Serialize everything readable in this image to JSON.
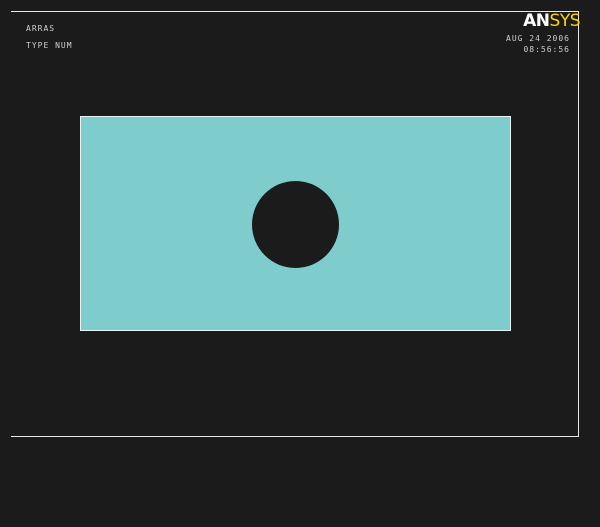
{
  "header": {
    "left_line1": "ARRAS",
    "left_line2": "TYPE NUM",
    "date": "AUG 24 2006",
    "time": "08:56:56"
  },
  "logo": {
    "part1": "AN",
    "part2": "SYS"
  },
  "colors": {
    "background": "#1b1b1b",
    "plate": "#7ecccc",
    "logo_yellow": "#ffd500",
    "frame": "#e6e6e6"
  }
}
